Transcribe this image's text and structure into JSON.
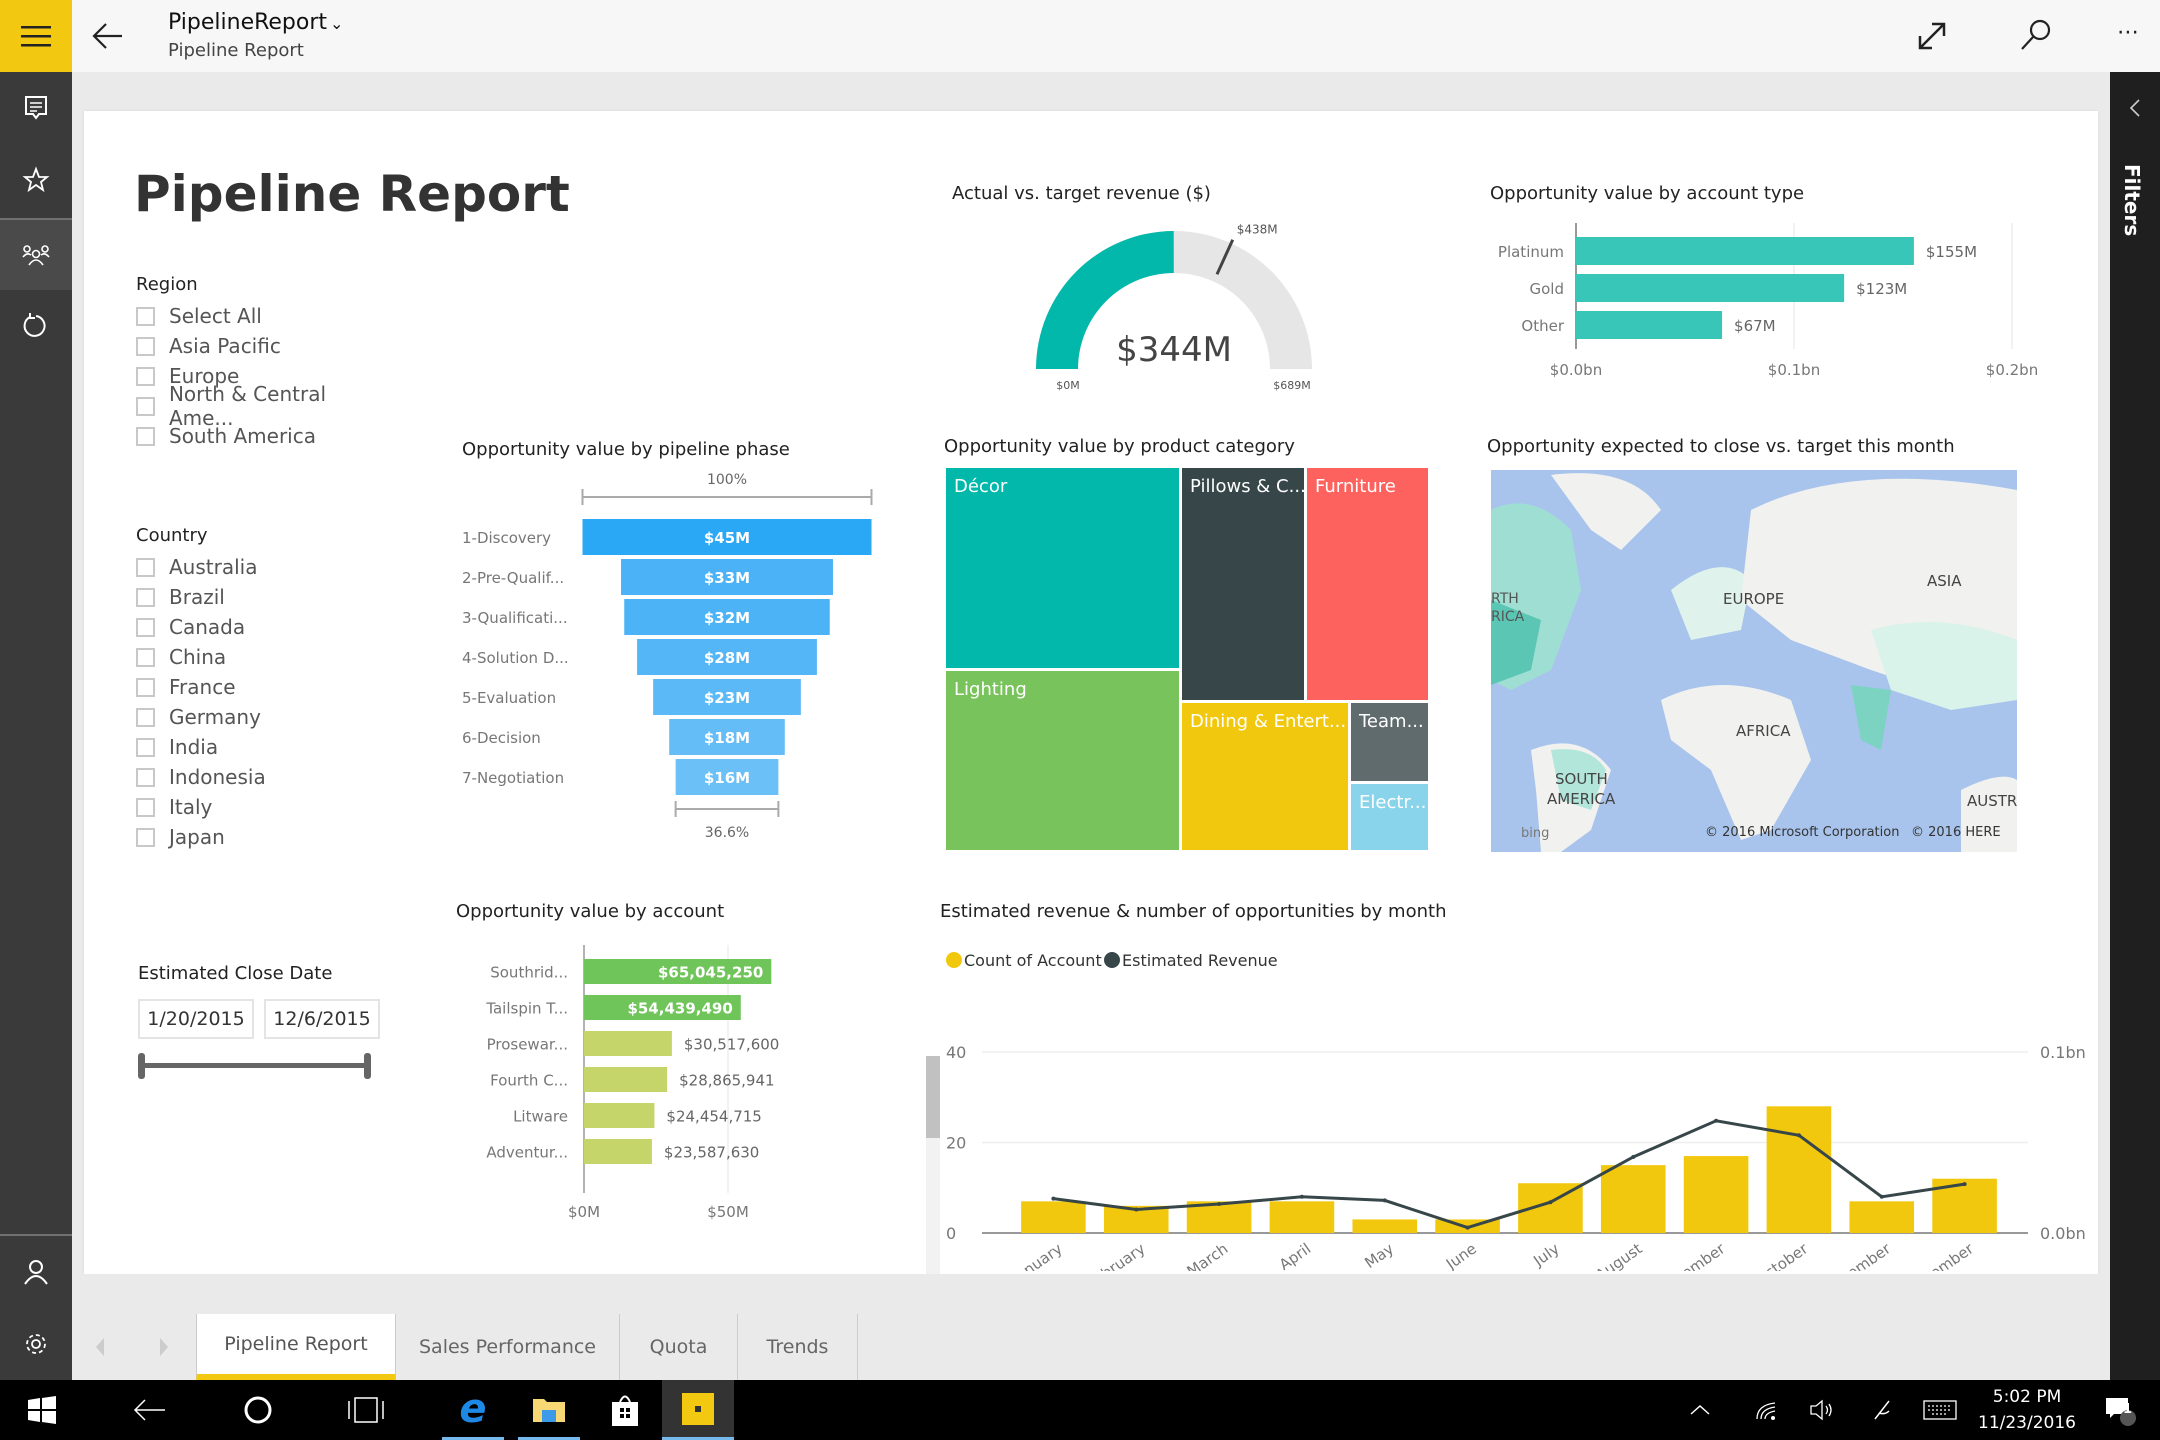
{
  "header": {
    "title": "PipelineReport",
    "subtitle": "Pipeline Report",
    "title_caret": "⌄"
  },
  "nav": {
    "items": [
      "comments",
      "favorites",
      "shared-with-me",
      "recent"
    ],
    "bottom": [
      "account",
      "settings"
    ]
  },
  "filters_pane": {
    "label": "Filters"
  },
  "report": {
    "title": "Pipeline Report",
    "region_slicer": {
      "label": "Region",
      "items": [
        "Select All",
        "Asia Pacific",
        "Europe",
        "North & Central Ame...",
        "South America"
      ]
    },
    "country_slicer": {
      "label": "Country",
      "items": [
        "Australia",
        "Brazil",
        "Canada",
        "China",
        "France",
        "Germany",
        "India",
        "Indonesia",
        "Italy",
        "Japan"
      ]
    },
    "date_slicer": {
      "label": "Estimated Close Date",
      "start": "1/20/2015",
      "end": "12/6/2015"
    },
    "map": {
      "title": "Opportunity expected to close vs. target this month",
      "labels": [
        "RTH",
        "RICA",
        "EUROPE",
        "ASIA",
        "AFRICA",
        "SOUTH",
        "AMERICA",
        "AUSTR"
      ],
      "bing": "bing",
      "copyright1": "© 2016 Microsoft Corporation",
      "copyright2": "© 2016 HERE"
    }
  },
  "chart_data": [
    {
      "id": "gauge",
      "type": "gauge",
      "title": "Actual vs. target  revenue ($)",
      "value": 344,
      "value_label": "$344M",
      "min": 0,
      "min_label": "$0M",
      "max": 689,
      "max_label": "$689M",
      "target": 438,
      "target_label": "$438M",
      "colors": {
        "fill": "#01b8aa",
        "track": "#e6e6e6"
      }
    },
    {
      "id": "account_type",
      "type": "bar",
      "orientation": "horizontal",
      "title": "Opportunity value by account type",
      "categories": [
        "Platinum",
        "Gold",
        "Other"
      ],
      "values": [
        155,
        123,
        67
      ],
      "data_labels": [
        "$155M",
        "$123M",
        "$67M"
      ],
      "xlim": [
        0,
        200
      ],
      "xticks": [
        "$0.0bn",
        "$0.1bn",
        "$0.2bn"
      ],
      "color": "#37c6b7"
    },
    {
      "id": "funnel",
      "type": "funnel",
      "title": "Opportunity value by pipeline phase",
      "categories": [
        "1-Discovery",
        "2-Pre-Qualif...",
        "3-Qualificati...",
        "4-Solution D...",
        "5-Evaluation",
        "6-Decision",
        "7-Negotiation"
      ],
      "values": [
        45,
        33,
        32,
        28,
        23,
        18,
        16
      ],
      "data_labels": [
        "$45M",
        "$33M",
        "$32M",
        "$28M",
        "$23M",
        "$18M",
        "$16M"
      ],
      "top_label": "100%",
      "bottom_label": "36.6%",
      "color": "#5cb7f5"
    },
    {
      "id": "treemap",
      "type": "treemap",
      "title": "Opportunity value by product category",
      "items": [
        {
          "label": "Décor",
          "color": "#01b8aa"
        },
        {
          "label": "Lighting",
          "color": "#78c35c"
        },
        {
          "label": "Pillows & C...",
          "color": "#374649"
        },
        {
          "label": "Furniture",
          "color": "#fd625e"
        },
        {
          "label": "Dining & Entert...",
          "color": "#f2c80f"
        },
        {
          "label": "Team...",
          "color": "#5f6b6d"
        },
        {
          "label": "Electr...",
          "color": "#8ad4eb"
        }
      ]
    },
    {
      "id": "accounts",
      "type": "bar",
      "orientation": "horizontal",
      "title": "Opportunity value by account",
      "categories": [
        "Southrid...",
        "Tailspin T...",
        "Prosewar...",
        "Fourth C...",
        "Litware",
        "Adventur..."
      ],
      "values": [
        65045250,
        54439490,
        30517600,
        28865941,
        24454715,
        23587630
      ],
      "data_labels": [
        "$65,045,250",
        "$54,439,490",
        "$30,517,600",
        "$28,865,941",
        "$24,454,715",
        "$23,587,630"
      ],
      "xlim": [
        0,
        75000000
      ],
      "xticks": [
        "$0M",
        "$50M"
      ],
      "colors": [
        "#6fc45a",
        "#6fc45a",
        "#c6d56a",
        "#c6d56a",
        "#c6d56a",
        "#c6d56a"
      ]
    },
    {
      "id": "monthly",
      "type": "bar",
      "combo": "bar+line",
      "title": "Estimated revenue & number of opportunities by month",
      "categories": [
        "January",
        "February",
        "March",
        "April",
        "May",
        "June",
        "July",
        "August",
        "September",
        "October",
        "November",
        "December"
      ],
      "series": [
        {
          "name": "Count of Account",
          "type": "bar",
          "axis": "left",
          "color": "#f2c80f",
          "values": [
            7,
            6,
            7,
            7,
            3,
            3,
            11,
            15,
            17,
            28,
            7,
            12
          ]
        },
        {
          "name": "Estimated Revenue",
          "type": "line",
          "axis": "right",
          "color": "#374649",
          "values": [
            0.019,
            0.013,
            0.016,
            0.02,
            0.018,
            0.003,
            0.017,
            0.042,
            0.062,
            0.054,
            0.02,
            0.027
          ]
        }
      ],
      "ylim_left": [
        0,
        40
      ],
      "yticks_left": [
        "0",
        "20",
        "40"
      ],
      "ylim_right": [
        0,
        0.1
      ],
      "yticks_right": [
        "0.0bn",
        "0.1bn"
      ],
      "legend": "top-left",
      "grid": true
    }
  ],
  "tabs": {
    "items": [
      "Pipeline Report",
      "Sales Performance",
      "Quota",
      "Trends"
    ],
    "active": 0
  },
  "taskbar": {
    "time": "5:02 PM",
    "date": "11/23/2016",
    "notification_count": "1"
  }
}
